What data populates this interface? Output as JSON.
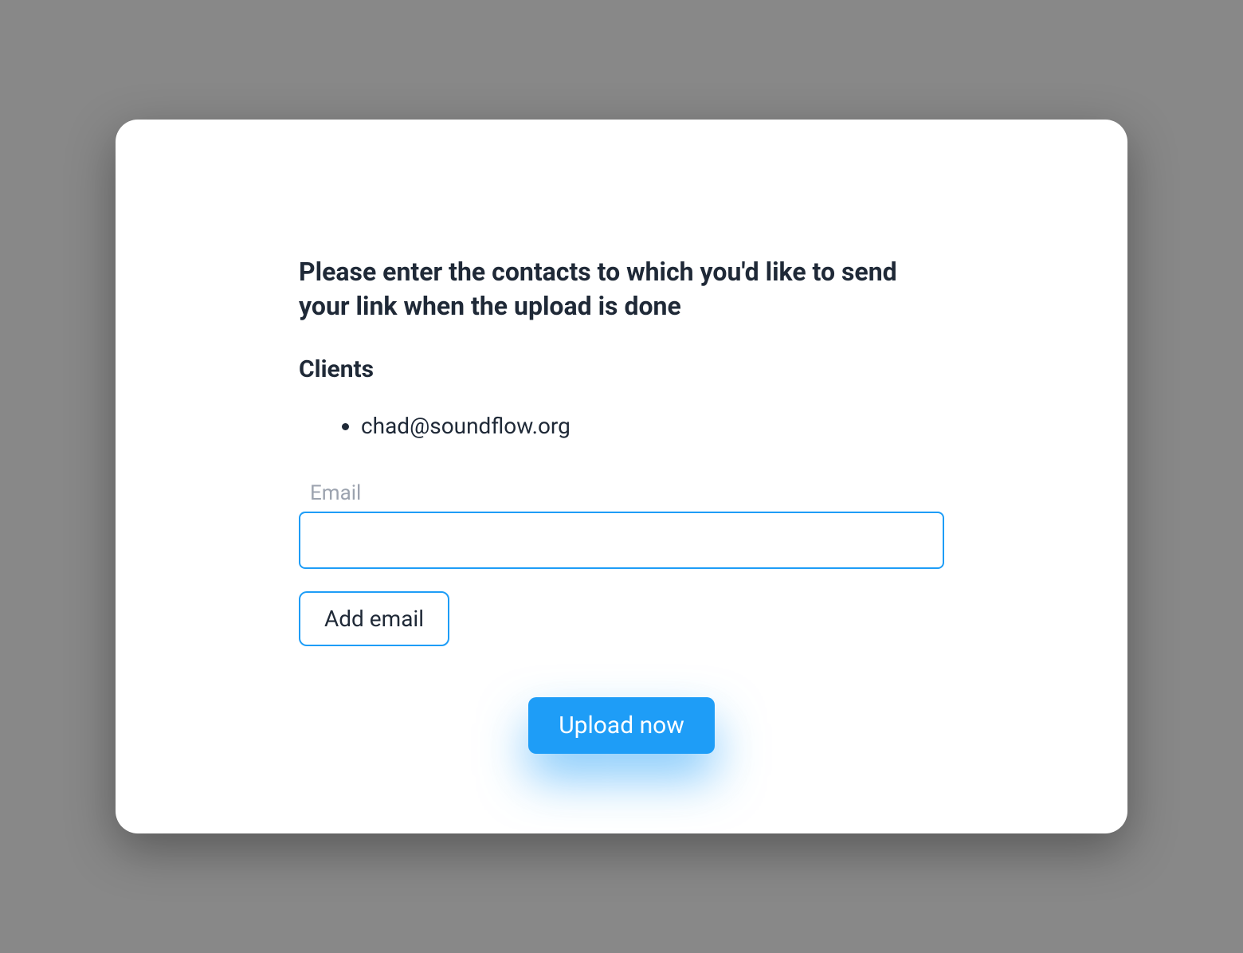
{
  "modal": {
    "title": "Please enter the contacts to which you'd like to send your link when the upload is done",
    "clients_heading": "Clients",
    "emails": [
      "chad@soundflow.org"
    ],
    "email_field": {
      "label": "Email",
      "value": ""
    },
    "add_email_label": "Add email",
    "upload_label": "Upload now"
  },
  "colors": {
    "accent": "#1e9df7",
    "text": "#1f2937",
    "muted": "#9ca3af",
    "backdrop": "#888888"
  }
}
